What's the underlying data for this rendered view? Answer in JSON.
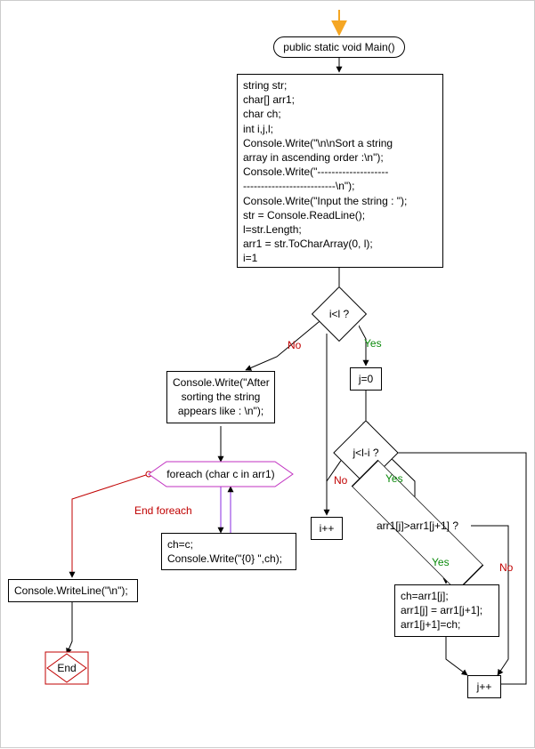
{
  "chart_data": {
    "type": "flowchart",
    "title": "",
    "nodes": [
      {
        "id": "start_arrow",
        "kind": "start-marker",
        "label": ""
      },
      {
        "id": "main",
        "kind": "terminator",
        "label": "public static void Main()"
      },
      {
        "id": "init",
        "kind": "process",
        "label": "string str;\nchar[] arr1;\nchar ch;\nint i,j,l;\nConsole.Write(\"\\n\\nSort a string\narray in ascending order :\\n\");\nConsole.Write(\"--------------------\n--------------------------\\n\");\nConsole.Write(\"Input the string : \");\nstr = Console.ReadLine();\nl=str.Length;\narr1 = str.ToCharArray(0, l);\ni=1"
      },
      {
        "id": "dec_i",
        "kind": "decision",
        "label": "i<l ?"
      },
      {
        "id": "j0",
        "kind": "process",
        "label": "j=0"
      },
      {
        "id": "dec_j",
        "kind": "decision",
        "label": "j<l-i ?"
      },
      {
        "id": "dec_cmp",
        "kind": "decision",
        "label": "arr1[j]>arr1[j+1] ?"
      },
      {
        "id": "swap",
        "kind": "process",
        "label": "ch=arr1[j];\narr1[j] = arr1[j+1];\narr1[j+1]=ch;"
      },
      {
        "id": "jpp",
        "kind": "process",
        "label": "j++"
      },
      {
        "id": "ipp",
        "kind": "process",
        "label": "i++"
      },
      {
        "id": "afterSort",
        "kind": "process",
        "label": "Console.Write(\"After\nsorting the string\nappears like : \\n\");"
      },
      {
        "id": "foreach",
        "kind": "loop",
        "label": "foreach (char c in arr1)"
      },
      {
        "id": "printc",
        "kind": "process",
        "label": "ch=c;\nConsole.Write(\"{0} \",ch);"
      },
      {
        "id": "println",
        "kind": "process",
        "label": "Console.WriteLine(\"\\n\");"
      },
      {
        "id": "end",
        "kind": "terminator",
        "label": "End"
      }
    ],
    "edges": [
      {
        "from": "start_arrow",
        "to": "main"
      },
      {
        "from": "main",
        "to": "init"
      },
      {
        "from": "init",
        "to": "dec_i"
      },
      {
        "from": "dec_i",
        "to": "j0",
        "label": "Yes"
      },
      {
        "from": "dec_i",
        "to": "afterSort",
        "label": "No"
      },
      {
        "from": "j0",
        "to": "dec_j"
      },
      {
        "from": "dec_j",
        "to": "dec_cmp",
        "label": "Yes"
      },
      {
        "from": "dec_j",
        "to": "ipp",
        "label": "No"
      },
      {
        "from": "dec_cmp",
        "to": "swap",
        "label": "Yes"
      },
      {
        "from": "dec_cmp",
        "to": "jpp",
        "label": "No"
      },
      {
        "from": "swap",
        "to": "jpp"
      },
      {
        "from": "jpp",
        "to": "dec_j"
      },
      {
        "from": "ipp",
        "to": "dec_i"
      },
      {
        "from": "afterSort",
        "to": "foreach"
      },
      {
        "from": "foreach",
        "to": "printc"
      },
      {
        "from": "printc",
        "to": "foreach"
      },
      {
        "from": "foreach",
        "to": "println",
        "label": "End foreach"
      },
      {
        "from": "println",
        "to": "end"
      }
    ],
    "edge_label_text": {
      "Yes": "Yes",
      "No": "No",
      "End foreach": "End foreach"
    }
  }
}
